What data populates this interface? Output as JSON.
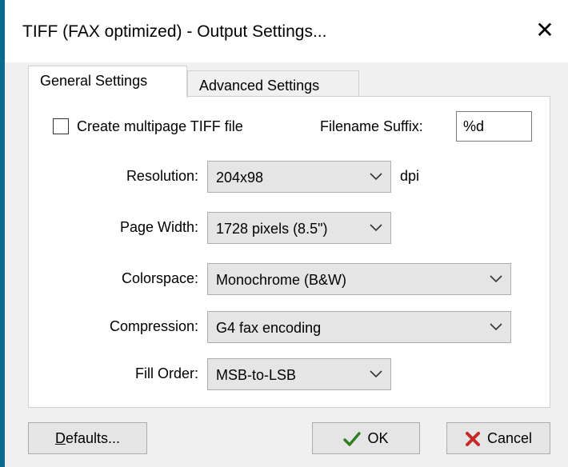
{
  "window": {
    "title": "TIFF (FAX optimized) - Output Settings...",
    "close_glyph": "✕"
  },
  "tabs": [
    {
      "label": "General Settings",
      "active": true
    },
    {
      "label": "Advanced Settings",
      "active": false
    }
  ],
  "general": {
    "multipage": {
      "label": "Create multipage TIFF file",
      "checked": false
    },
    "suffix": {
      "label": "Filename Suffix:",
      "value": "%d"
    },
    "resolution": {
      "label": "Resolution:",
      "value": "204x98",
      "unit": "dpi"
    },
    "page_width": {
      "label": "Page Width:",
      "value": "1728 pixels (8.5\")"
    },
    "colorspace": {
      "label": "Colorspace:",
      "value": "Monochrome (B&W)"
    },
    "compression": {
      "label": "Compression:",
      "value": "G4 fax encoding"
    },
    "fill_order": {
      "label": "Fill Order:",
      "value": "MSB-to-LSB"
    }
  },
  "buttons": {
    "defaults": {
      "mnemonic": "D",
      "rest": "efaults..."
    },
    "ok": {
      "label": "OK",
      "icon": "checkmark-icon",
      "icon_color": "#2e7d1f"
    },
    "cancel": {
      "label": "Cancel",
      "icon": "cross-icon",
      "icon_color": "#c62828"
    }
  }
}
